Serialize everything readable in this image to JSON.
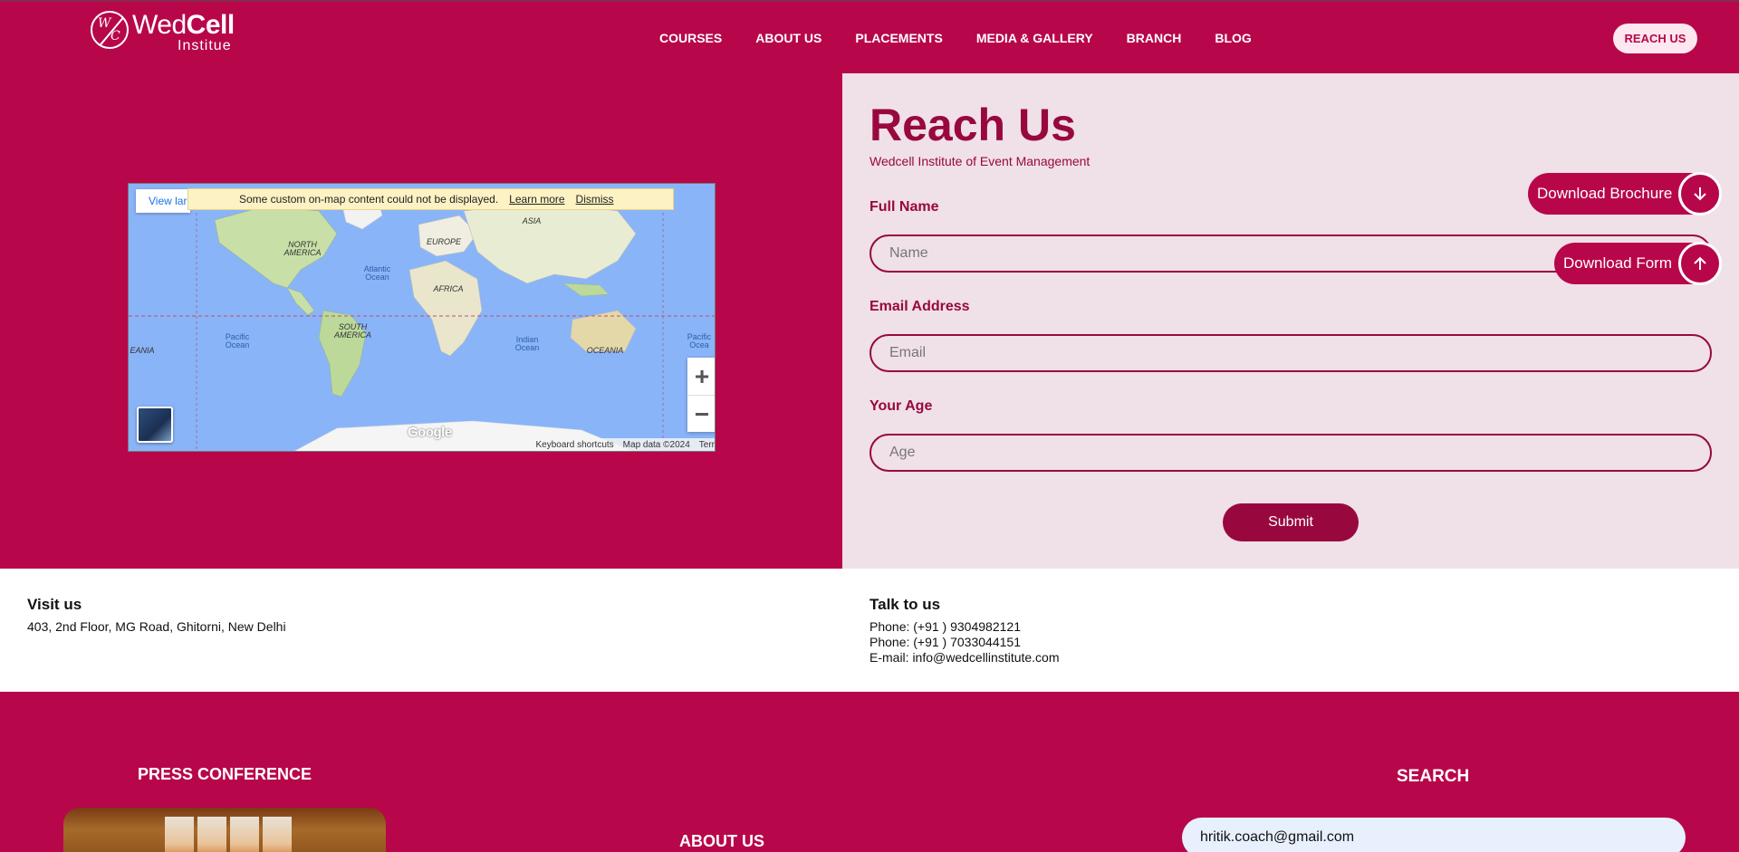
{
  "header": {
    "logo_brand_light": "Wed",
    "logo_brand_bold": "Cell",
    "logo_subtitle": "Institue",
    "logo_mark_w": "W",
    "logo_mark_c": "C",
    "nav": [
      "COURSES",
      "ABOUT US",
      "PLACEMENTS",
      "MEDIA & GALLERY",
      "BRANCH",
      "BLOG"
    ],
    "cta_label": "REACH US"
  },
  "map": {
    "view_larger": "View lar",
    "notice_text": "Some custom on-map content could not be displayed.",
    "learn_more": "Learn more",
    "dismiss": "Dismiss",
    "zoom_in": "+",
    "zoom_out": "−",
    "google": "Google",
    "keyboard_shortcuts": "Keyboard shortcuts",
    "map_data": "Map data ©2024",
    "terms": "Terr",
    "labels": {
      "north_america": "NORTH AMERICA",
      "south_america": "SOUTH AMERICA",
      "europe": "EUROPE",
      "africa": "AFRICA",
      "asia": "ASIA",
      "oceania": "OCEANIA",
      "oceania_left": "EANIA",
      "atlantic": "Atlantic Ocean",
      "pacific": "Pacific Ocean",
      "pacific_right": "Pacific Ocea",
      "indian": "Indian Ocean"
    }
  },
  "form": {
    "title": "Reach Us",
    "subtitle": "Wedcell Institute of Event Management",
    "full_name_label": "Full Name",
    "full_name_placeholder": "Name",
    "email_label": "Email Address",
    "email_placeholder": "Email",
    "age_label": "Your Age",
    "age_placeholder": "Age",
    "submit_label": "Submit",
    "download_brochure": "Download Brochure",
    "download_form": "Download Form"
  },
  "contact": {
    "visit_title": "Visit us",
    "visit_address": "403, 2nd Floor, MG Road, Ghitorni, New Delhi",
    "talk_title": "Talk to us",
    "phone1": "Phone: (+91 ) 9304982121",
    "phone2": "Phone: (+91 ) 7033044151",
    "email": "E-mail: info@wedcellinstitute.com"
  },
  "footer": {
    "press_title": "PRESS CONFERENCE",
    "about_title": "ABOUT US",
    "search_title": "SEARCH",
    "search_value": "hritik.coach@gmail.com"
  },
  "colors": {
    "brand": "#b8064b",
    "brand_dark": "#98083f",
    "panel_bg": "#f0e0e8",
    "map_water": "#8ab4f8"
  }
}
